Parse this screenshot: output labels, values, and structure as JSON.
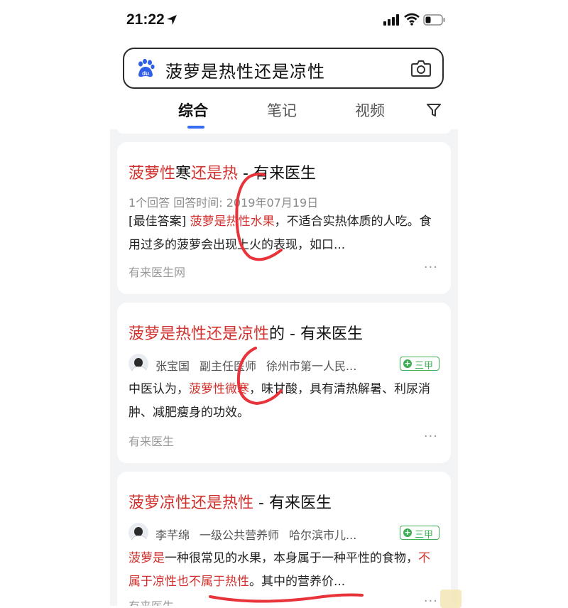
{
  "status_bar": {
    "time": "21:22"
  },
  "search": {
    "query": "菠萝是热性还是凉性"
  },
  "tabs": [
    {
      "label": "综合",
      "active": true
    },
    {
      "label": "笔记",
      "active": false
    },
    {
      "label": "视频",
      "active": false
    }
  ],
  "results": [
    {
      "title_parts": [
        "菠萝性",
        "寒",
        "还是热",
        " - 有来医生"
      ],
      "meta": "1个回答  回答时间: 2019年07月19日",
      "body_parts": [
        "[最佳答案] ",
        "菠萝是热性水果",
        "，不适合实热体质的人吃。食用过多的菠萝会出现上火的表现，如口..."
      ],
      "source": "有来医生网",
      "more": "···"
    },
    {
      "title_parts": [
        "菠萝是热性还是凉性",
        "的 - 有来医生"
      ],
      "doctor": {
        "name": "张宝国",
        "title": "副主任医师",
        "hospital": "徐州市第一人民...",
        "badge": "三甲"
      },
      "body_parts": [
        "中医认为，",
        "菠萝性微寒",
        "，味甘酸，具有清热解暑、利尿消肿、减肥瘦身的功效。"
      ],
      "source": "有来医生",
      "more": "···"
    },
    {
      "title_parts": [
        "菠萝凉性还是热性",
        " - 有来医生"
      ],
      "doctor": {
        "name": "李芊绵",
        "title": "一级公共营养师",
        "hospital": "哈尔滨市儿...",
        "badge": "三甲"
      },
      "body_parts": [
        "菠萝是",
        "一种很常见的水果，本身属于一种平性的食物，",
        "不属于凉性也不属于热性",
        "。其中的营养价..."
      ],
      "source": "有来医生",
      "more": "···"
    }
  ],
  "colors": {
    "highlight": "#d0312d",
    "accent": "#3b6cf6",
    "badge": "#3fae55",
    "annotation": "#e8333a"
  }
}
